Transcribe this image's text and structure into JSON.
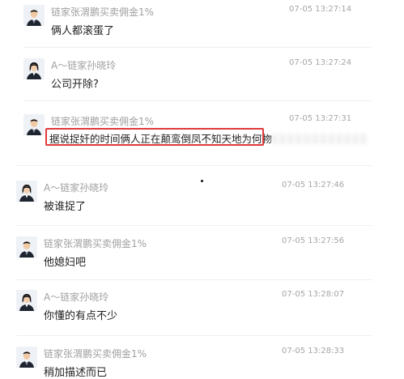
{
  "messages": [
    {
      "sender": "链家张渭鹏买卖佣金1%",
      "time": "07-05 13:27:14",
      "text": "俩人都滚蛋了",
      "avatar": "male-avatar"
    },
    {
      "sender": "A～链家孙晓玲",
      "time": "07-05 13:27:24",
      "text": "公司开除?",
      "avatar": "female-avatar"
    },
    {
      "sender": "链家张渭鹏买卖佣金1%",
      "time": "07-05 13:27:31",
      "text": "据说捉奸的时间俩人正在颠鸾倒凤不知天地为何物",
      "avatar": "male-avatar"
    },
    {
      "sender": "A～链家孙晓玲",
      "time": "07-05 13:27:46",
      "text": "被谁捉了",
      "avatar": "female-avatar"
    },
    {
      "sender": "链家张渭鹏买卖佣金1%",
      "time": "07-05 13:27:56",
      "text": "他媳妇吧",
      "avatar": "male-avatar"
    },
    {
      "sender": "A～链家孙晓玲",
      "time": "07-05 13:28:07",
      "text": "你懂的有点不少",
      "avatar": "female-avatar"
    },
    {
      "sender": "链家张渭鹏买卖佣金1%",
      "time": "07-05 13:28:33",
      "text": "稍加描述而已",
      "avatar": "male-avatar"
    }
  ],
  "colors": {
    "highlight": "#e03a3a",
    "sender_text": "#a0a0a0",
    "message_text": "#222222"
  }
}
